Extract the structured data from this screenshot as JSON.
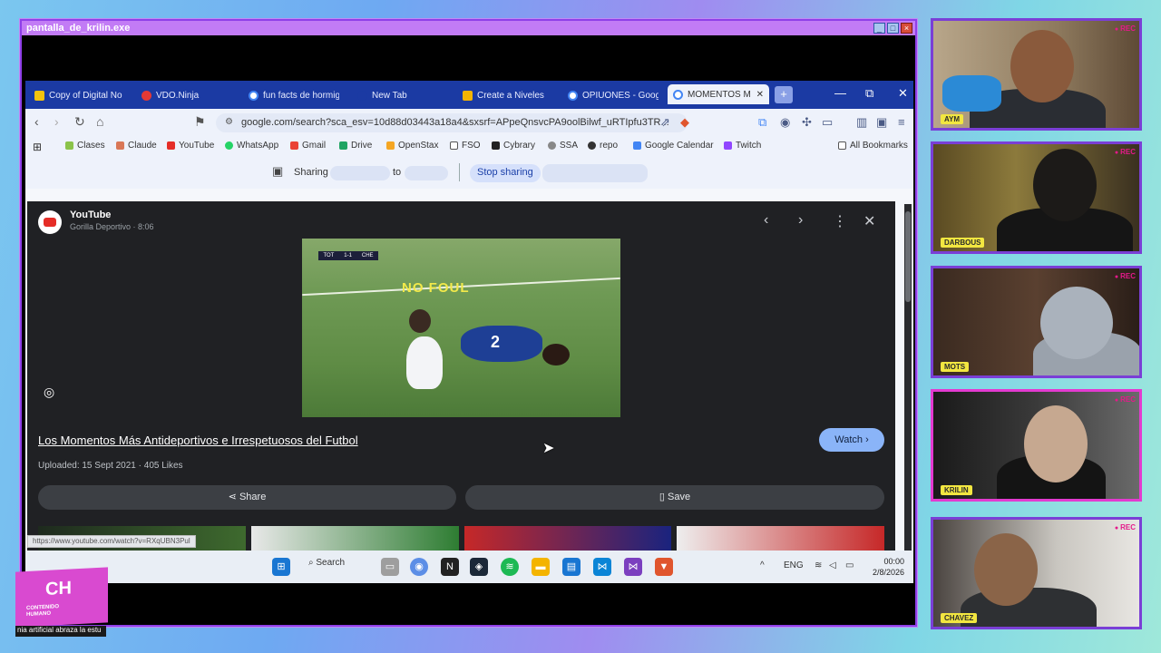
{
  "window": {
    "title": "pantalla_de_krilin.exe",
    "min": "_",
    "max": "□",
    "close": "×"
  },
  "browser": {
    "tabs": [
      {
        "label": "Copy of Digital No",
        "color": "#f4c20d"
      },
      {
        "label": "VDO.Ninja",
        "color": "#e53935"
      },
      {
        "label": "fun facts de hormig",
        "color": "#4285f4"
      },
      {
        "label": "New Tab",
        "color": "#1b3aa3"
      },
      {
        "label": "Create a Niveles",
        "color": "#f4b400"
      },
      {
        "label": "OPIUONES - Goog",
        "color": "#4285f4"
      },
      {
        "label": "MOMENTOS M",
        "color": "#4285f4"
      }
    ],
    "new_tab": "+",
    "controls": {
      "minimize": "—",
      "restore": "⧉",
      "close": "✕"
    },
    "url": "google.com/search?sca_esv=10d88d03443a18a4&sxsrf=APpeQnsvcPA9oolBilwf_uRTIpfu3TR...",
    "bookmarks": [
      {
        "label": "Clases",
        "color": "#8bc34a"
      },
      {
        "label": "Claude",
        "color": "#d97757"
      },
      {
        "label": "YouTube",
        "color": "#e52d27"
      },
      {
        "label": "WhatsApp",
        "color": "#25d366"
      },
      {
        "label": "Gmail",
        "color": "#ea4335"
      },
      {
        "label": "Drive",
        "color": "#1fa463"
      },
      {
        "label": "OpenStax",
        "color": "#f5a623"
      },
      {
        "label": "FSO",
        "color": "#555555"
      },
      {
        "label": "Cybrary",
        "color": "#222222"
      },
      {
        "label": "SSA",
        "color": "#888888"
      },
      {
        "label": "repo",
        "color": "#333333"
      },
      {
        "label": "Google Calendar",
        "color": "#4285f4"
      },
      {
        "label": "Twitch",
        "color": "#9146ff"
      }
    ],
    "all_bookmarks": "All Bookmarks",
    "share": {
      "sharing": "Sharing",
      "to": "to",
      "stop": "Stop sharing"
    }
  },
  "panel": {
    "channel": "YouTube",
    "sub": "Gorilla Deportivo · 8:06",
    "overlay_text": "NO FOUL",
    "jersey_number": "2",
    "scoreboard": [
      "TOT",
      "1-1",
      "CHE"
    ],
    "title": "Los Momentos Más Antideportivos e Irrespetuosos del Futbol",
    "meta": "Uploaded: 15 Sept 2021 · 405 Likes",
    "watch": "Watch ›",
    "share": "Share",
    "save": "Save",
    "status_url": "https://www.youtube.com/watch?v=RXqUBN3Pul"
  },
  "taskbar": {
    "search": "Search",
    "lang": "ENG",
    "time": "00:00",
    "date": "2/8/2026"
  },
  "cams": [
    {
      "name": "AYM",
      "rec": "REC",
      "active": false
    },
    {
      "name": "DARBOUS",
      "rec": "REC",
      "active": false
    },
    {
      "name": "MOTS",
      "rec": "REC",
      "active": false
    },
    {
      "name": "KRILIN",
      "rec": "REC",
      "active": true
    },
    {
      "name": "CHAVEZ",
      "rec": "REC",
      "active": false
    }
  ],
  "brand": {
    "logo": "CH",
    "logo_sub1": "CONTENIDO",
    "logo_sub2": "HUMANO",
    "ticker": "nia artificial abraza la estu"
  }
}
